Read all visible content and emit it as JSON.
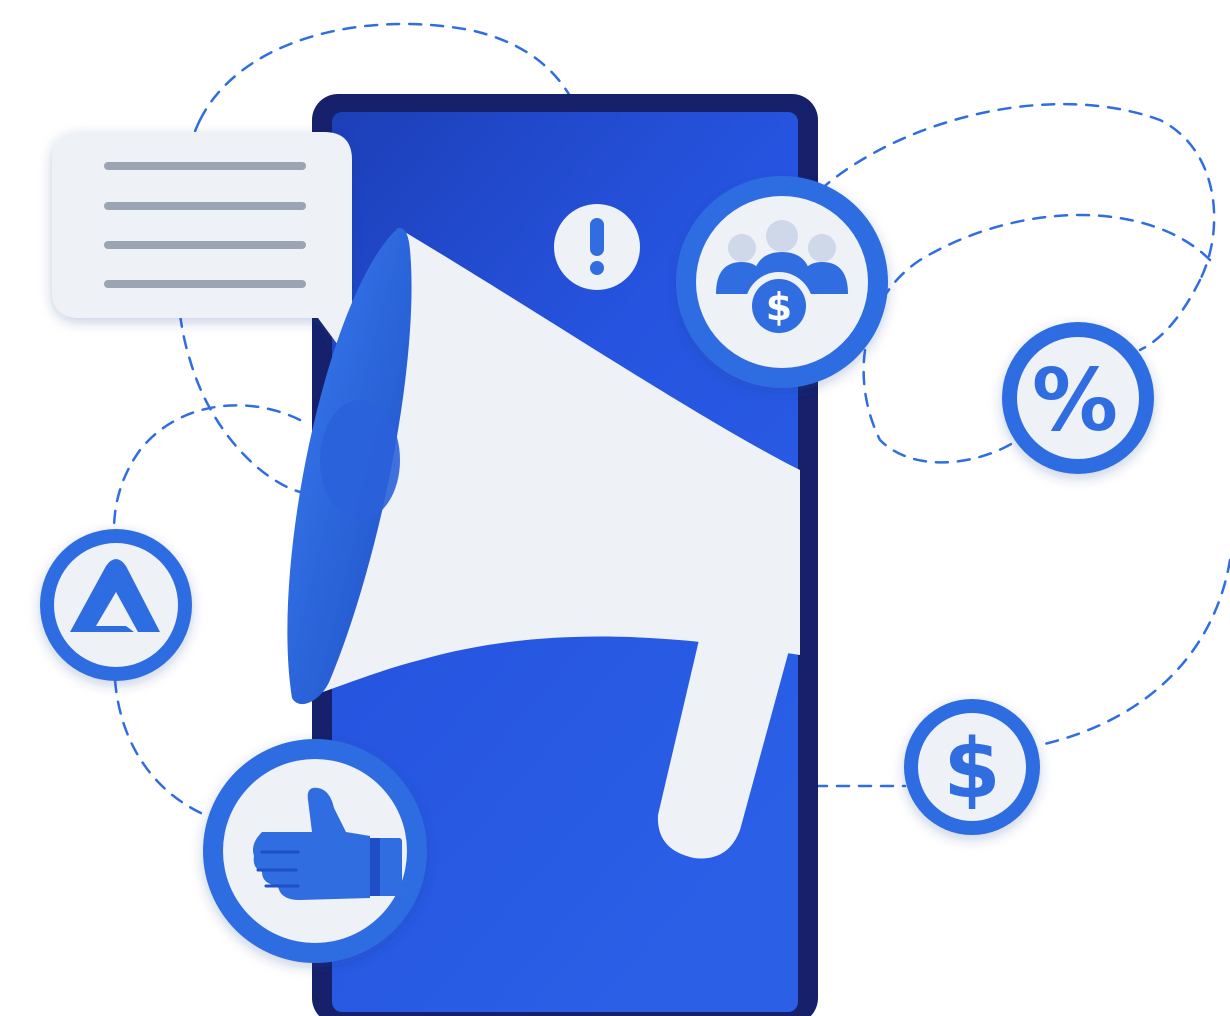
{
  "illustration": {
    "subject": "megaphone-on-phone-marketing",
    "colors": {
      "primary_blue": "#2f6de1",
      "deep_navy": "#16206b",
      "screen_blue": "#2450d8",
      "light_bg": "#eef1f6",
      "line_gray": "#9aa4b2",
      "white": "#ffffff"
    },
    "icons": {
      "exclamation": "!",
      "percent": "%",
      "dollar": "$",
      "brand_letter": "A",
      "group_dollar": "$"
    }
  }
}
